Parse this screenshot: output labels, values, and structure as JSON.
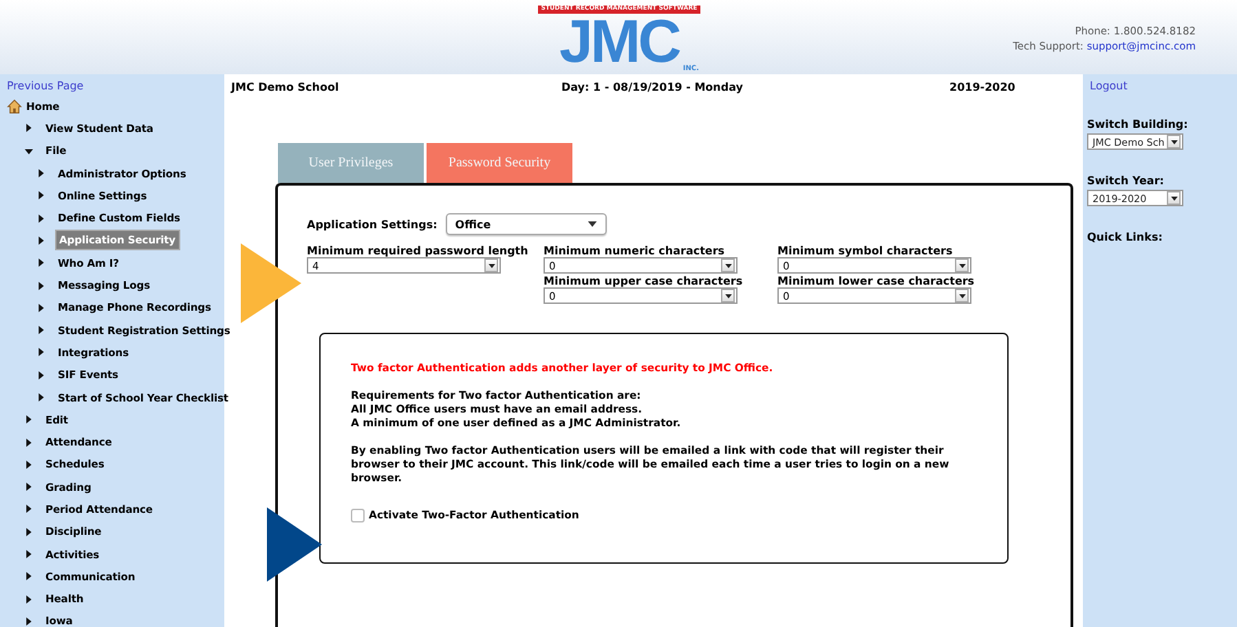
{
  "header": {
    "logo": {
      "letters": "JMC",
      "banner": "STUDENT RECORD MANAGEMENT SOFTWARE",
      "suffix": "INC."
    },
    "phone": "Phone: 1.800.524.8182",
    "support_label": "Tech Support:",
    "support_link": "support@jmcinc.com"
  },
  "left_sidebar": {
    "previous_page": "Previous Page",
    "items": [
      {
        "label": "Home",
        "kind": "home",
        "selected": false,
        "children": [
          {
            "label": "View Student Data",
            "expanded": false,
            "selected": false
          },
          {
            "label": "File",
            "expanded": true,
            "selected": false,
            "children": [
              {
                "label": "Administrator Options",
                "expanded": false,
                "selected": false
              },
              {
                "label": "Online Settings",
                "expanded": false,
                "selected": false
              },
              {
                "label": "Define Custom Fields",
                "expanded": false,
                "selected": false
              },
              {
                "label": "Application Security",
                "expanded": false,
                "selected": true
              },
              {
                "label": "Who Am I?",
                "expanded": false,
                "selected": false
              },
              {
                "label": "Messaging Logs",
                "expanded": false,
                "selected": false
              },
              {
                "label": "Manage Phone Recordings",
                "expanded": false,
                "selected": false
              },
              {
                "label": "Student Registration Settings",
                "expanded": false,
                "selected": false
              },
              {
                "label": "Integrations",
                "expanded": false,
                "selected": false
              },
              {
                "label": "SIF Events",
                "expanded": false,
                "selected": false
              },
              {
                "label": "Start of School Year Checklist",
                "expanded": false,
                "selected": false
              }
            ]
          },
          {
            "label": "Edit",
            "expanded": false,
            "selected": false
          },
          {
            "label": "Attendance",
            "expanded": false,
            "selected": false
          },
          {
            "label": "Schedules",
            "expanded": false,
            "selected": false
          },
          {
            "label": "Grading",
            "expanded": false,
            "selected": false
          },
          {
            "label": "Period Attendance",
            "expanded": false,
            "selected": false
          },
          {
            "label": "Discipline",
            "expanded": false,
            "selected": false
          },
          {
            "label": "Activities",
            "expanded": false,
            "selected": false
          },
          {
            "label": "Communication",
            "expanded": false,
            "selected": false
          },
          {
            "label": "Health",
            "expanded": false,
            "selected": false
          },
          {
            "label": "Iowa",
            "expanded": false,
            "selected": false
          }
        ]
      }
    ]
  },
  "top_bar": {
    "school": "JMC Demo School",
    "day": "Day: 1 - 08/19/2019 - Monday",
    "year": "2019-2020"
  },
  "tabs": [
    {
      "label": "User Privileges",
      "selected": false
    },
    {
      "label": "Password Security",
      "selected": true
    }
  ],
  "application_settings": {
    "label": "Application Settings:",
    "value": "Office"
  },
  "password_fields": [
    {
      "label": "Minimum required password length",
      "value": "4"
    },
    {
      "label": "Minimum numeric characters",
      "value": "0"
    },
    {
      "label": "Minimum symbol characters",
      "value": "0"
    },
    {
      "label": "Minimum upper case characters",
      "value": "0"
    },
    {
      "label": "Minimum lower case characters",
      "value": "0"
    }
  ],
  "two_factor": {
    "notice": "Two factor Authentication adds another layer of security to JMC Office.",
    "requirements": [
      "Requirements for Two factor Authentication are:",
      "All JMC Office users must have an email address.",
      "A minimum of one user defined as a JMC Administrator."
    ],
    "description": "By enabling Two factor Authentication users will be emailed a link with code that will register their browser to their JMC account. This link/code will be emailed each time a user tries to login on a new browser.",
    "checkbox": {
      "label": "Activate Two-Factor Authentication",
      "checked": false
    }
  },
  "right_sidebar": {
    "logout": "Logout",
    "switch_building": {
      "label": "Switch Building:",
      "value": "JMC Demo Sch"
    },
    "switch_year": {
      "label": "Switch Year:",
      "value": "2019-2020"
    },
    "quick_links": "Quick Links:"
  },
  "annotations": [
    {
      "color": "#fbb63a"
    },
    {
      "color": "#02478a"
    }
  ]
}
